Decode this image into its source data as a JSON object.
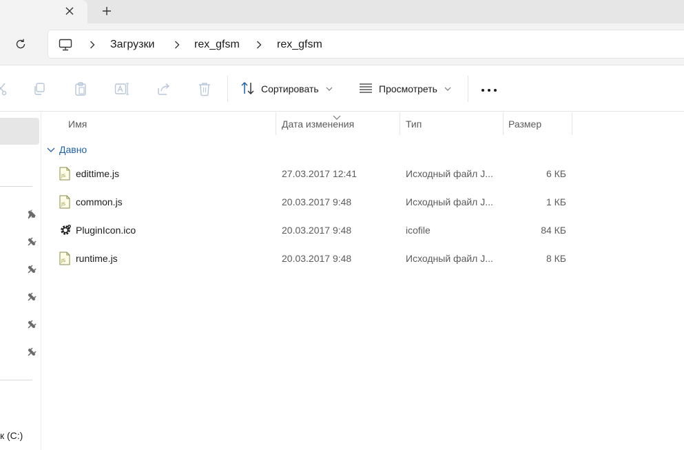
{
  "tabs": {
    "close_icon": "close-icon",
    "new_tab_icon": "plus-icon"
  },
  "address": {
    "root_icon": "computer-icon",
    "crumbs": [
      "Загрузки",
      "rex_gfsm",
      "rex_gfsm"
    ]
  },
  "toolbar": {
    "sort_label": "Сортировать",
    "view_label": "Просмотреть",
    "more_label": "···",
    "icons": [
      "cut-icon",
      "copy-icon",
      "paste-icon",
      "rename-icon",
      "share-icon",
      "delete-icon"
    ]
  },
  "nav": {
    "drive_label": "к (C:)"
  },
  "columns": {
    "name": "Имя",
    "date": "Дата изменения",
    "type": "Тип",
    "size": "Размер"
  },
  "group": {
    "label": "Давно"
  },
  "files": [
    {
      "name": "edittime.js",
      "date": "27.03.2017 12:41",
      "type": "Исходный файл J...",
      "size": "6 КБ",
      "icon": "js-file-icon"
    },
    {
      "name": "common.js",
      "date": "20.03.2017 9:48",
      "type": "Исходный файл J...",
      "size": "1 КБ",
      "icon": "js-file-icon"
    },
    {
      "name": "PluginIcon.ico",
      "date": "20.03.2017 9:48",
      "type": "icofile",
      "size": "84 КБ",
      "icon": "gear-file-icon"
    },
    {
      "name": "runtime.js",
      "date": "20.03.2017 9:48",
      "type": "Исходный файл J...",
      "size": "8 КБ",
      "icon": "js-file-icon"
    }
  ],
  "colors": {
    "accent": "#1f5fa8",
    "tabbar": "#e6e6e6",
    "toolbar_bg": "#f3f3f3"
  }
}
